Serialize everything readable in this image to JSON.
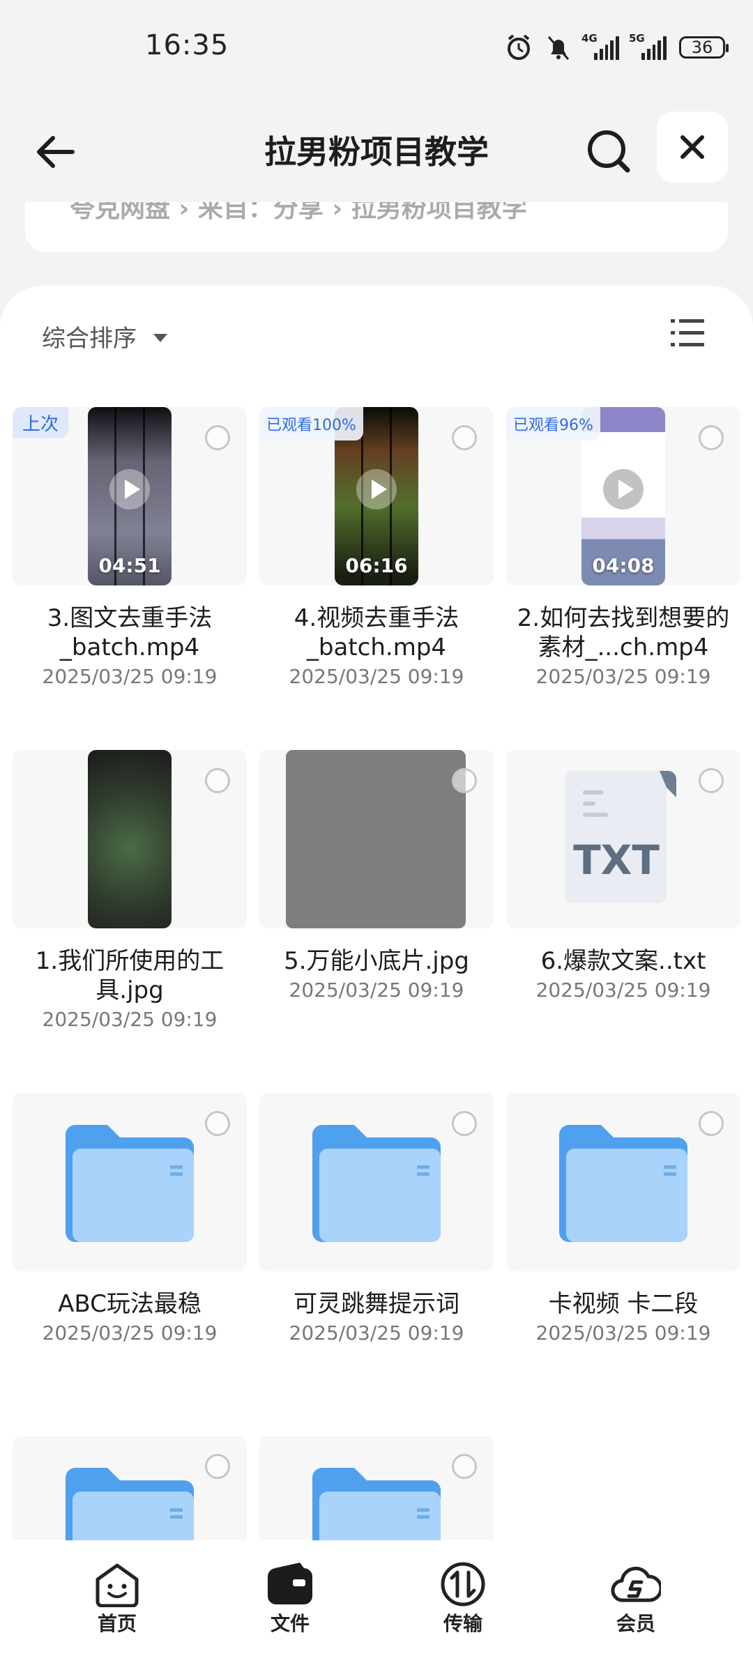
{
  "status_bar": {
    "time": "16:35",
    "network_1": "4G",
    "network_2": "5G",
    "battery": "36"
  },
  "header": {
    "title": "拉男粉项目教学"
  },
  "breadcrumb": {
    "text": "夸克网盘 › 来自：分享 › 拉男粉项目教学"
  },
  "toolbar": {
    "sort_label": "综合排序"
  },
  "files": [
    {
      "name": "3.图文去重手法_batch.mp4",
      "date": "2025/03/25 09:19",
      "type": "video",
      "badge": "上次",
      "duration": "04:51"
    },
    {
      "name": "4.视频去重手法_batch.mp4",
      "date": "2025/03/25 09:19",
      "type": "video",
      "badge": "已观看100%",
      "duration": "06:16"
    },
    {
      "name": "2.如何去找到想要的素材_...ch.mp4",
      "date": "2025/03/25 09:19",
      "type": "video",
      "badge": "已观看96%",
      "duration": "04:08"
    },
    {
      "name": "1.我们所使用的工具.jpg",
      "date": "2025/03/25 09:19",
      "type": "image"
    },
    {
      "name": "5.万能小底片.jpg",
      "date": "2025/03/25 09:19",
      "type": "image-gray"
    },
    {
      "name": "6.爆款文案..txt",
      "date": "2025/03/25 09:19",
      "type": "txt",
      "icon_text": "TXT"
    },
    {
      "name": "ABC玩法最稳",
      "date": "2025/03/25 09:19",
      "type": "folder"
    },
    {
      "name": "可灵跳舞提示词",
      "date": "2025/03/25 09:19",
      "type": "folder"
    },
    {
      "name": "卡视频 卡二段",
      "date": "2025/03/25 09:19",
      "type": "folder"
    },
    {
      "name": "",
      "date": "",
      "type": "folder"
    },
    {
      "name": "",
      "date": "",
      "type": "folder"
    }
  ],
  "bottom_nav": [
    {
      "label": "首页",
      "icon": "home-face-icon"
    },
    {
      "label": "文件",
      "icon": "wallet-folder-icon"
    },
    {
      "label": "传输",
      "icon": "transfer-icon"
    },
    {
      "label": "会员",
      "icon": "cloud-s-icon"
    }
  ],
  "colors": {
    "accent": "#2c6be4",
    "folder": "#5aa7f2",
    "background": "#f3f3f5"
  }
}
